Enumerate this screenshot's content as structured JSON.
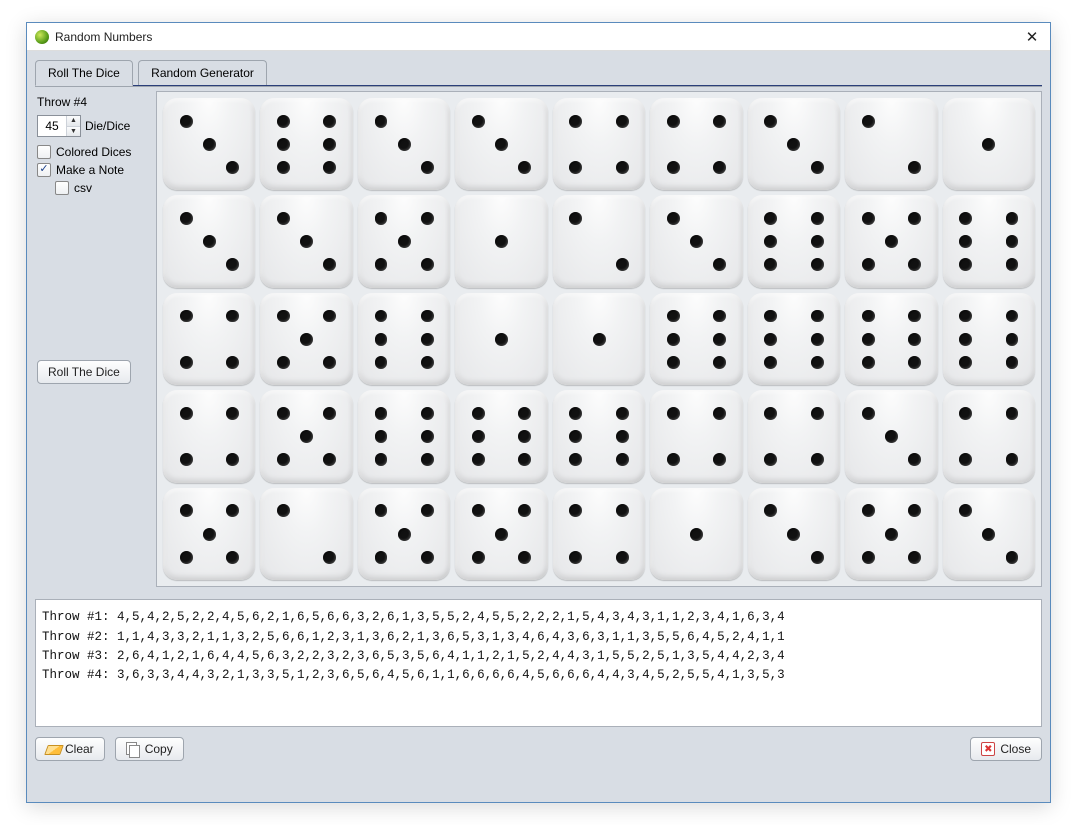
{
  "window": {
    "title": "Random Numbers"
  },
  "tabs": {
    "roll": "Roll The Dice",
    "generator": "Random Generator"
  },
  "sidebar": {
    "throw_label": "Throw #4",
    "die_count": "45",
    "die_label": "Die/Dice",
    "colored_label": "Colored Dices",
    "note_label": "Make a Note",
    "csv_label": "csv",
    "roll_button": "Roll The Dice"
  },
  "dice": [
    3,
    6,
    3,
    3,
    4,
    4,
    3,
    2,
    1,
    3,
    3,
    5,
    1,
    2,
    3,
    6,
    5,
    6,
    4,
    5,
    6,
    1,
    1,
    6,
    6,
    6,
    6,
    4,
    5,
    6,
    6,
    6,
    4,
    4,
    3,
    4,
    5,
    2,
    5,
    5,
    4,
    1,
    3,
    5,
    3
  ],
  "notes": [
    "Throw #1: 4,5,4,2,5,2,2,4,5,6,2,1,6,5,6,6,3,2,6,1,3,5,5,2,4,5,5,2,2,2,1,5,4,3,4,3,1,1,2,3,4,1,6,3,4",
    "Throw #2: 1,1,4,3,3,2,1,1,3,2,5,6,6,1,2,3,1,3,6,2,1,3,6,5,3,1,3,4,6,4,3,6,3,1,1,3,5,5,6,4,5,2,4,1,1",
    "Throw #3: 2,6,4,1,2,1,6,4,4,5,6,3,2,2,3,2,3,6,5,3,5,6,4,1,1,2,1,5,2,4,4,3,1,5,5,2,5,1,3,5,4,4,2,3,4",
    "Throw #4: 3,6,3,3,4,4,3,2,1,3,3,5,1,2,3,6,5,6,4,5,6,1,1,6,6,6,6,4,5,6,6,6,4,4,3,4,5,2,5,5,4,1,3,5,3"
  ],
  "buttons": {
    "clear": "Clear",
    "copy": "Copy",
    "close": "Close"
  }
}
